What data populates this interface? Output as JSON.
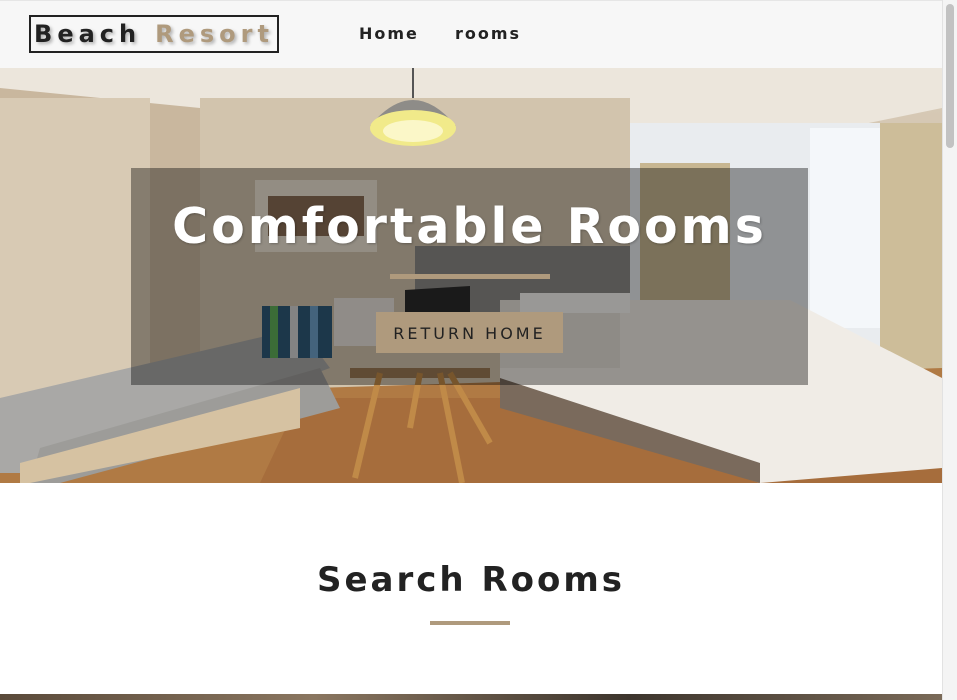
{
  "navbar": {
    "logo_word1": "Beach",
    "logo_word2": "Resort",
    "links": [
      {
        "label": "Home"
      },
      {
        "label": "rooms"
      }
    ]
  },
  "hero": {
    "title": "Comfortable Rooms",
    "button_label": "RETURN HOME",
    "background_image": "hotel-room-photo"
  },
  "search": {
    "title": "Search Rooms"
  },
  "colors": {
    "accent": "#af9a7d",
    "text": "#222222",
    "navbar_bg": "#f7f7f7",
    "banner_overlay": "rgba(0,0,0,0.38)"
  }
}
